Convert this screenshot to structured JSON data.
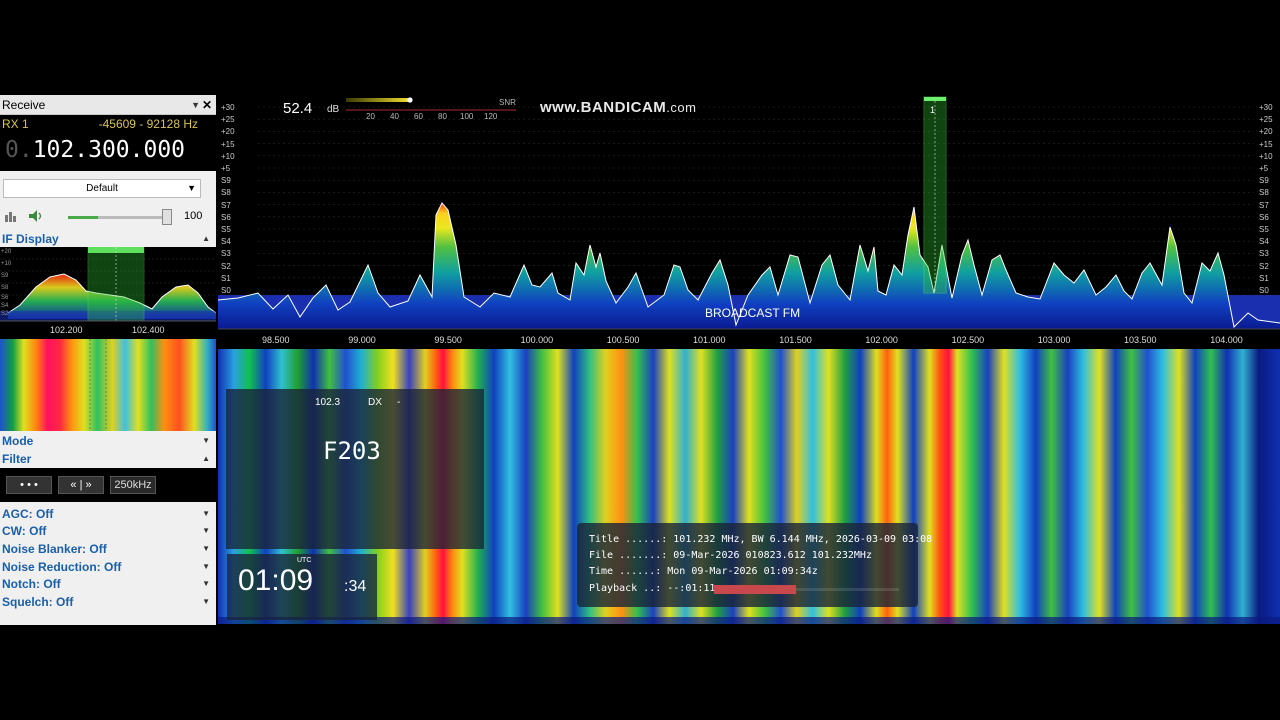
{
  "receive_panel": {
    "title": "Receive",
    "rx_label": "RX 1",
    "rx_range": "-45609 - 92128 Hz",
    "frequency_prefix": "0.",
    "frequency": "102.300.000",
    "preset": "Default",
    "volume": "100",
    "volume_level": 0.29
  },
  "if_display": {
    "title": "IF Display",
    "ticks": [
      "102.200",
      "102.400"
    ],
    "scale": [
      "+20",
      "+10",
      "S9",
      "S8",
      "S6",
      "S4",
      "S2"
    ]
  },
  "sections": {
    "mode": "Mode",
    "filter": "Filter"
  },
  "filter": {
    "btn_dots": "• • •",
    "btn_nav": "« | »",
    "bandwidth": "250kHz"
  },
  "options": {
    "agc": "AGC: Off",
    "cw": "CW: Off",
    "noise_blanker": "Noise Blanker: Off",
    "noise_reduction": "Noise Reduction: Off",
    "notch": "Notch: Off",
    "squelch": "Squelch: Off"
  },
  "spectrum": {
    "snr_value": "52.4",
    "snr_unit": "dB",
    "snr_label": "SNR",
    "snr_ticks": [
      "20",
      "40",
      "60",
      "80",
      "100",
      "120"
    ],
    "watermark_main": "www.BANDICAM",
    "watermark_tail": ".com",
    "band_label": "BROADCAST FM",
    "marker_number": "1",
    "scale_left": [
      "+30",
      "+25",
      "+20",
      "+15",
      "+10",
      "+5",
      "S9",
      "S8",
      "S7",
      "S6",
      "S5",
      "S4",
      "S3",
      "S2",
      "S1",
      "S0"
    ],
    "scale_right": [
      "+30",
      "+25",
      "+20",
      "+15",
      "+10",
      "+5",
      "S9",
      "S8",
      "S7",
      "S6",
      "S5",
      "S4",
      "S3",
      "S2",
      "S1",
      "S0"
    ],
    "freq_ticks": [
      "98.500",
      "99.000",
      "99.500",
      "100.000",
      "100.500",
      "101.000",
      "101.500",
      "102.000",
      "102.500",
      "103.000",
      "103.500",
      "104.000"
    ],
    "colors": {
      "marker": "#2fc42f",
      "trace": "#ffffff",
      "noise_floor": "#1a2fb0"
    }
  },
  "rds": {
    "pi": "102.3",
    "mode": "DX",
    "dash": "-",
    "ps": "F203"
  },
  "clock": {
    "utc_label": "UTC",
    "hm": "01:09",
    "seconds": ":34"
  },
  "file_info": {
    "title": "Title ......: 101.232 MHz, BW 6.144 MHz, 2026-03-09 03:08",
    "file": "File .......: 09-Mar-2026 010823.612 101.232MHz",
    "time": "Time ......: Mon 09-Mar-2026 01:09:34z",
    "playback": "Playback ..: --:01:11",
    "playback_progress": 0.44
  }
}
